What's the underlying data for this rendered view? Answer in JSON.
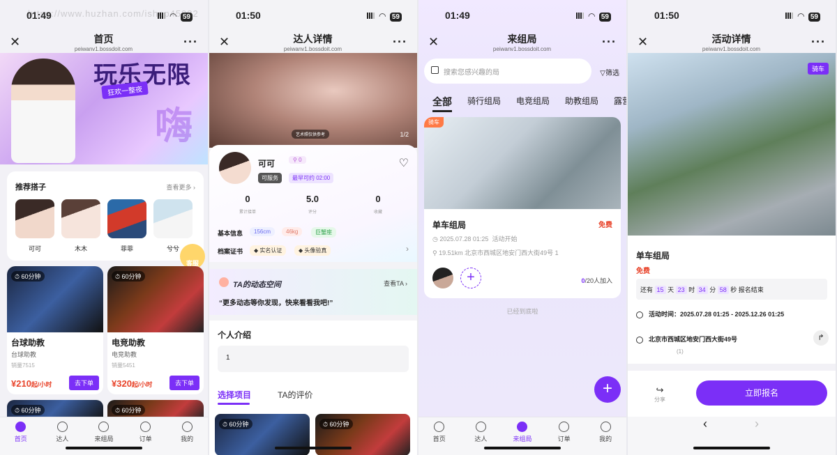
{
  "watermark": "https://www.huzhan.com/ishop45282",
  "statusbar": {
    "time1": "01:49",
    "time2": "01:50",
    "time3": "01:49",
    "time4": "01:50",
    "battery": "59"
  },
  "nav": {
    "host": "peiwanv1.bossdoit.com",
    "home_title": "首页",
    "detail_title": "达人详情",
    "group_title": "来组局",
    "event_title": "活动详情"
  },
  "tabs": [
    "首页",
    "达人",
    "来组局",
    "订单",
    "我的"
  ],
  "home": {
    "banner_title": "玩乐无限",
    "banner_tag": "狂欢一整夜",
    "banner_big": "嗨",
    "rec_title": "推荐搭子",
    "rec_more": "查看更多",
    "rec_people": [
      "可可",
      "木木",
      "菲菲",
      "兮兮"
    ],
    "kefu": "客服",
    "services": [
      {
        "duration": "60分钟",
        "title": "台球助教",
        "category": "台球助教",
        "sales": "销量7515",
        "price": "¥210",
        "unit": "起/小时",
        "button": "去下单"
      },
      {
        "duration": "60分钟",
        "title": "电竞助教",
        "category": "电竞助教",
        "sales": "销量5451",
        "price": "¥320",
        "unit": "起/小时",
        "button": "去下单"
      }
    ],
    "peek_durations": [
      "60分钟",
      "60分钟"
    ]
  },
  "detail": {
    "caption": "艺术照仅供参考",
    "pager": "1/2",
    "name": "可可",
    "distance": "0",
    "status": "可服务",
    "earliest": "最早可约 02:00",
    "stats": [
      {
        "value": "0",
        "label": "累计接单"
      },
      {
        "value": "5.0",
        "label": "评分"
      },
      {
        "value": "0",
        "label": "收藏"
      }
    ],
    "info_label": "基本信息",
    "info_tags": [
      "156cm",
      "46kg",
      "巨蟹座"
    ],
    "cert_label": "档案证书",
    "cert_tags": [
      "实名认证",
      "头像验真"
    ],
    "dyn_title": "TA的动态空间",
    "dyn_more": "查看TA",
    "dyn_quote": "“更多动态等你发现，快来看看我吧!”",
    "intro_title": "个人介绍",
    "intro_text": "1",
    "sel_tab1": "选择项目",
    "sel_tab2": "TA的评价",
    "sel_durations": [
      "60分钟",
      "60分钟"
    ]
  },
  "group": {
    "search_placeholder": "搜索您感兴趣的局",
    "filter": "筛选",
    "tabs": [
      "全部",
      "骑行组局",
      "电竞组局",
      "助教组局",
      "露营组局"
    ],
    "event": {
      "tag": "骑车",
      "title": "单车组局",
      "fee": "免费",
      "time": "2025.07.28 01:25",
      "time_label": "活动开始",
      "location": "19.51km  北京市西城区地安门西大街49号 1",
      "joined": "0",
      "capacity": "/20人加入"
    },
    "end_text": "已经到底啦"
  },
  "event": {
    "tag": "骑车",
    "title": "单车组局",
    "fee": "免费",
    "countdown": {
      "pre": "还有",
      "days": "15",
      "d": "天",
      "hours": "23",
      "h": "时",
      "minutes": "34",
      "m": "分",
      "seconds": "58",
      "s": "秒",
      "post": "报名结束"
    },
    "time_text": "活动时间：2025.07.28 01:25 - 2025.12.26 01:25",
    "address": "北京市西城区地安门西大街49号",
    "address_count": "(1)",
    "share": "分享",
    "signup": "立即报名"
  }
}
